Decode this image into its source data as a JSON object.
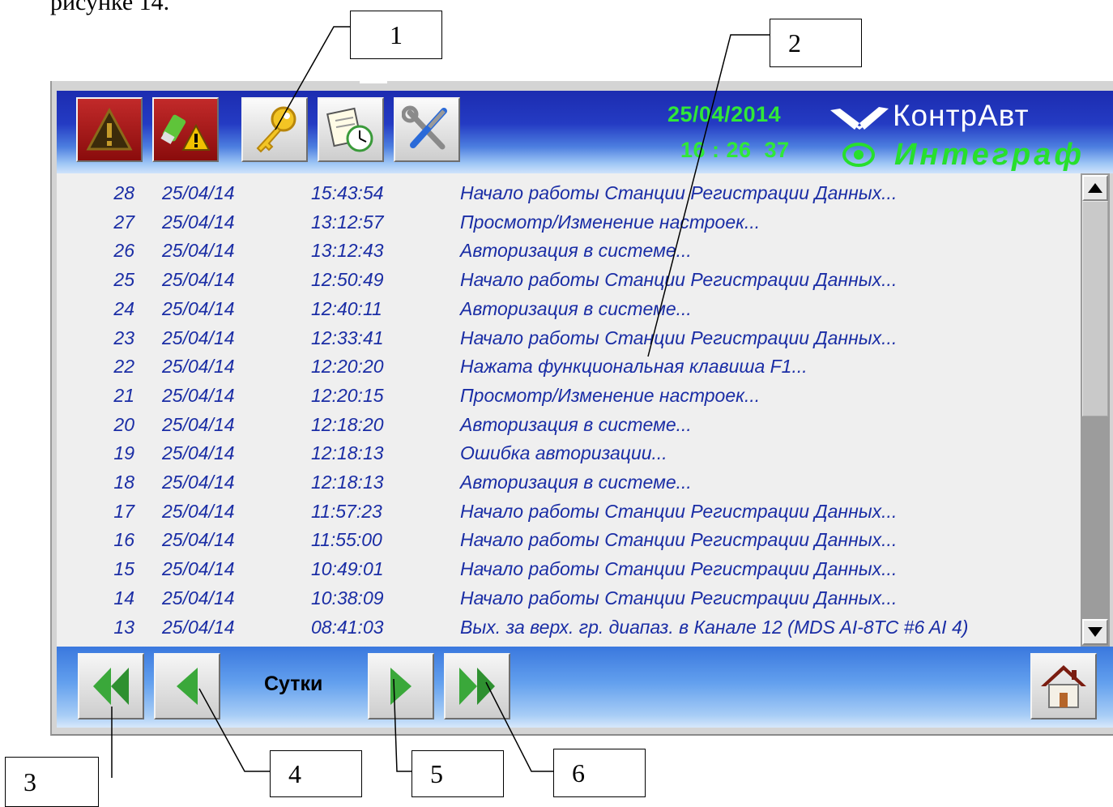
{
  "page_text": "рисунке 14.",
  "callouts": [
    "1",
    "2",
    "3",
    "4",
    "5",
    "6"
  ],
  "header": {
    "date": "25/04/2014",
    "time": "16 : 26  37",
    "logo_name": "КонтрАвт",
    "logo_sub": "Интеграф",
    "buttons": [
      {
        "icon": "alarm-warning-icon"
      },
      {
        "icon": "usb-warning-icon"
      },
      {
        "icon": "key-icon"
      },
      {
        "icon": "notepad-clock-icon"
      },
      {
        "icon": "tools-icon"
      }
    ]
  },
  "log": [
    {
      "num": "28",
      "date": "25/04/14",
      "time": "15:43:54",
      "msg": "Начало работы Станции Регистрации Данных..."
    },
    {
      "num": "27",
      "date": "25/04/14",
      "time": "13:12:57",
      "msg": "Просмотр/Изменение настроек..."
    },
    {
      "num": "26",
      "date": "25/04/14",
      "time": "13:12:43",
      "msg": "Авторизация в системе..."
    },
    {
      "num": "25",
      "date": "25/04/14",
      "time": "12:50:49",
      "msg": "Начало работы Станции Регистрации Данных..."
    },
    {
      "num": "24",
      "date": "25/04/14",
      "time": "12:40:11",
      "msg": "Авторизация в системе..."
    },
    {
      "num": "23",
      "date": "25/04/14",
      "time": "12:33:41",
      "msg": "Начало работы Станции Регистрации Данных..."
    },
    {
      "num": "22",
      "date": "25/04/14",
      "time": "12:20:20",
      "msg": "Нажата функциональная клавиша F1..."
    },
    {
      "num": "21",
      "date": "25/04/14",
      "time": "12:20:15",
      "msg": "Просмотр/Изменение настроек..."
    },
    {
      "num": "20",
      "date": "25/04/14",
      "time": "12:18:20",
      "msg": "Авторизация в системе..."
    },
    {
      "num": "19",
      "date": "25/04/14",
      "time": "12:18:13",
      "msg": "Ошибка авторизации..."
    },
    {
      "num": "18",
      "date": "25/04/14",
      "time": "12:18:13",
      "msg": "Авторизация в системе..."
    },
    {
      "num": "17",
      "date": "25/04/14",
      "time": "11:57:23",
      "msg": "Начало работы Станции Регистрации Данных..."
    },
    {
      "num": "16",
      "date": "25/04/14",
      "time": "11:55:00",
      "msg": "Начало работы Станции Регистрации Данных..."
    },
    {
      "num": "15",
      "date": "25/04/14",
      "time": "10:49:01",
      "msg": "Начало работы Станции Регистрации Данных..."
    },
    {
      "num": "14",
      "date": "25/04/14",
      "time": "10:38:09",
      "msg": "Начало работы Станции Регистрации Данных..."
    },
    {
      "num": "13",
      "date": "25/04/14",
      "time": "08:41:03",
      "msg": "Вых. за верх. гр. диапаз. в Канале 12 (MDS AI-8TC #6 AI 4)"
    }
  ],
  "footer": {
    "period_label": "Сутки",
    "buttons": {
      "first": "double-left-arrow-icon",
      "prev": "left-arrow-icon",
      "next": "right-arrow-icon",
      "last": "double-right-arrow-icon",
      "home": "home-icon"
    }
  },
  "colors": {
    "header_blue": "#1c2cb0",
    "datetime_green": "#30e838",
    "log_text": "#1a2da5",
    "nav_arrow_green": "#3aa83a"
  }
}
